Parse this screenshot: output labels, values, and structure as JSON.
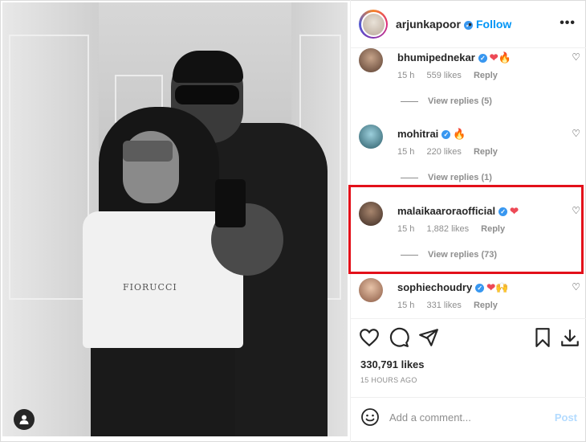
{
  "post": {
    "author": "arjunkapoor",
    "follow_label": "Follow",
    "dot": "•",
    "more_icon": "more-horizontal-icon",
    "photo_text": "FIORUCCI"
  },
  "comments": [
    {
      "username": "bhumipednekar",
      "emoji": "❤🔥",
      "time": "15 h",
      "likes": "559 likes",
      "reply": "Reply",
      "view_replies": "View replies (5)"
    },
    {
      "username": "mohitrai",
      "emoji": "🔥",
      "time": "15 h",
      "likes": "220 likes",
      "reply": "Reply",
      "view_replies": "View replies (1)"
    },
    {
      "username": "malaikaaroraofficial",
      "emoji": "❤",
      "time": "15 h",
      "likes": "1,882 likes",
      "reply": "Reply",
      "view_replies": "View replies (73)"
    },
    {
      "username": "sophiechoudry",
      "emoji": "❤🙌",
      "time": "15 h",
      "likes": "331 likes",
      "reply": "Reply"
    }
  ],
  "stats": {
    "likes": "330,791 likes",
    "posted": "15 HOURS AGO"
  },
  "composer": {
    "placeholder": "Add a comment...",
    "post_label": "Post"
  },
  "colors": {
    "accent": "#0095f6",
    "highlight": "#e3101a",
    "verified": "#3897f0",
    "muted": "#8e8e8e"
  }
}
